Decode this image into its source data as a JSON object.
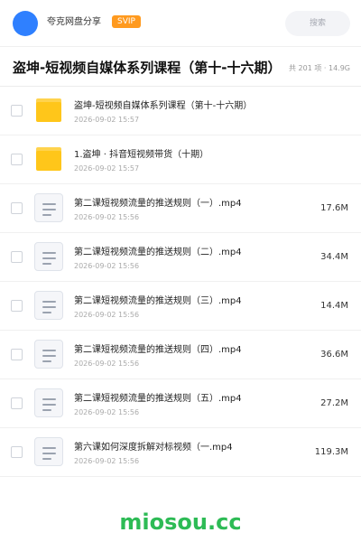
{
  "header": {
    "share_name": "夸克网盘分享",
    "badge": "SVIP",
    "search_placeholder": "搜索"
  },
  "folder": {
    "title": "盗坤-短视频自媒体系列课程（第十-十六期）",
    "meta": "共 201 项 · 14.9G"
  },
  "files": [
    {
      "type": "folder",
      "name": "盗坤-短视频自媒体系列课程（第十-十六期）",
      "date": "2026-09-02 15:57",
      "size": ""
    },
    {
      "type": "folder",
      "name": "1.盗坤 · 抖音短视频带货（十期）",
      "date": "2026-09-02 15:57",
      "size": ""
    },
    {
      "type": "file",
      "name": "第二课短视频流量的推送规则（一）.mp4",
      "date": "2026-09-02 15:56",
      "size": "17.6M"
    },
    {
      "type": "file",
      "name": "第二课短视频流量的推送规则（二）.mp4",
      "date": "2026-09-02 15:56",
      "size": "34.4M"
    },
    {
      "type": "file",
      "name": "第二课短视频流量的推送规则（三）.mp4",
      "date": "2026-09-02 15:56",
      "size": "14.4M"
    },
    {
      "type": "file",
      "name": "第二课短视频流量的推送规则（四）.mp4",
      "date": "2026-09-02 15:56",
      "size": "36.6M"
    },
    {
      "type": "file",
      "name": "第二课短视频流量的推送规则（五）.mp4",
      "date": "2026-09-02 15:56",
      "size": "27.2M"
    },
    {
      "type": "file",
      "name": "第六课如何深度拆解对标视频（一.mp4",
      "date": "2026-09-02 15:56",
      "size": "119.3M"
    }
  ],
  "watermark": "miosou.cc",
  "colors": {
    "accent": "#2f80ff",
    "badge": "#ff9a1f",
    "folder": "#ffc61a",
    "watermark": "#2dbb55"
  },
  "icons": {
    "folder": "folder-icon",
    "file": "video-file-icon"
  }
}
